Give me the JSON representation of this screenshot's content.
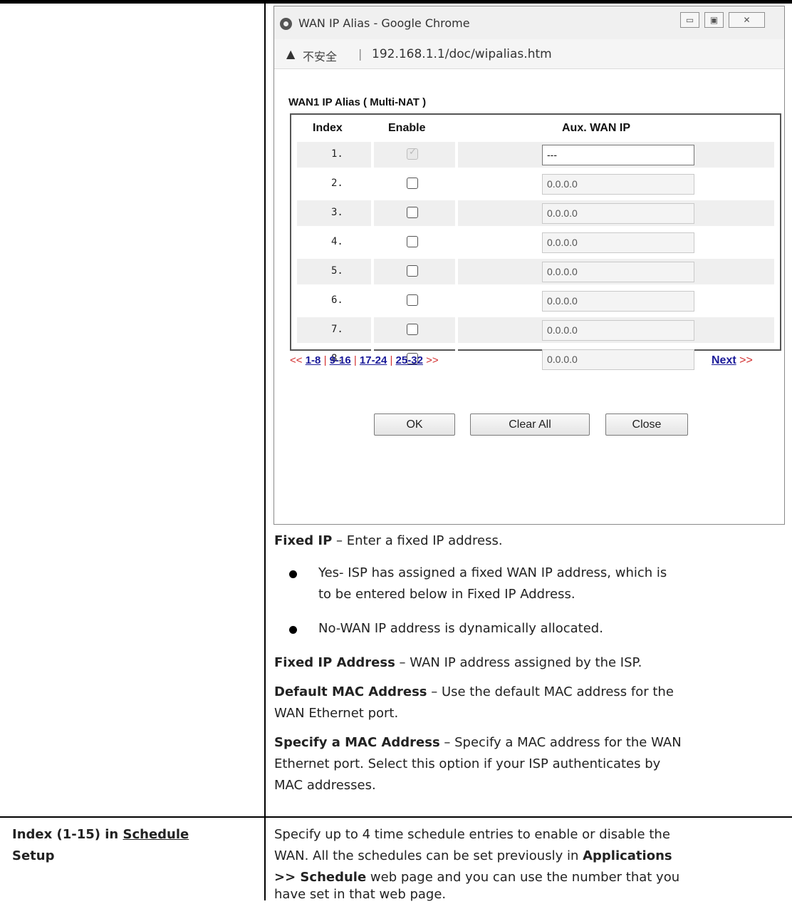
{
  "browser": {
    "window_title": "WAN IP Alias - Google Chrome",
    "security_label": "不安全",
    "url": "192.168.1.1/doc/wipalias.htm",
    "controls": {
      "minimize": "▭",
      "maximize": "▣",
      "close": "✕"
    }
  },
  "alias_dialog": {
    "section_title": "WAN1  IP Alias ( Multi-NAT )",
    "columns": {
      "index": "Index",
      "enable": "Enable",
      "aux_wan_ip": "Aux. WAN IP"
    },
    "rows": [
      {
        "index": "1.",
        "enabled": true,
        "ip": "---"
      },
      {
        "index": "2.",
        "enabled": false,
        "ip": "0.0.0.0"
      },
      {
        "index": "3.",
        "enabled": false,
        "ip": "0.0.0.0"
      },
      {
        "index": "4.",
        "enabled": false,
        "ip": "0.0.0.0"
      },
      {
        "index": "5.",
        "enabled": false,
        "ip": "0.0.0.0"
      },
      {
        "index": "6.",
        "enabled": false,
        "ip": "0.0.0.0"
      },
      {
        "index": "7.",
        "enabled": false,
        "ip": "0.0.0.0"
      },
      {
        "index": "8.",
        "enabled": false,
        "ip": "0.0.0.0"
      }
    ],
    "pager": {
      "prev_arrow": "<<",
      "pages": [
        "1-8",
        "9-16",
        "17-24",
        "25-32"
      ],
      "separator": "|",
      "next_arrow": ">>",
      "next_label": "Next"
    },
    "buttons": {
      "ok": "OK",
      "clear_all": "Clear All",
      "close": "Close"
    }
  },
  "doc": {
    "fixed_ip": {
      "term": "Fixed IP",
      "desc": " – Enter a fixed IP address."
    },
    "bullet_yes": {
      "line1": "Yes- ISP has assigned a fixed WAN IP address, which is",
      "line2": "to be entered below in Fixed IP Address."
    },
    "bullet_no": "No-WAN IP address is dynamically allocated.",
    "fixed_ip_address": {
      "term": "Fixed IP Address",
      "desc": " – WAN IP address assigned by the ISP."
    },
    "default_mac": {
      "term": "Default MAC Address",
      "desc1": " – Use the default MAC address for the",
      "desc2": "WAN Ethernet port."
    },
    "specify_mac": {
      "term": "Specify a MAC Address",
      "desc1": " – Specify a MAC address for the WAN",
      "line2": "Ethernet port. Select this option if your ISP authenticates by",
      "line3": "MAC addresses."
    },
    "schedule": {
      "label_prefix": "Index (1-15) in ",
      "label_link": "Schedule",
      "label_suffix": "Setup",
      "line1": "Specify up to 4 time schedule entries to enable or disable the",
      "line2_pre": "WAN. All the schedules can be set previously in ",
      "line2_bold": "Applications",
      "line3_bold": ">> Schedule",
      "line3_post": " web page and you can use the number that you",
      "line4": "have set in that web page."
    }
  }
}
